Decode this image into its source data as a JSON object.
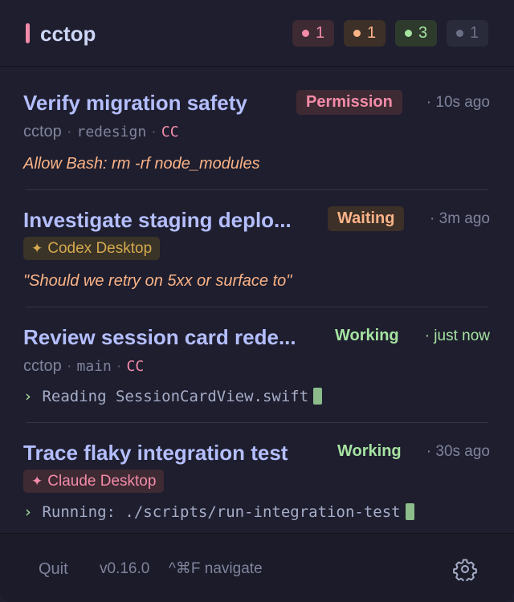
{
  "app": {
    "title": "cctop",
    "accent_color": "#f38ba8"
  },
  "badges": [
    {
      "count": "1",
      "color": "#f38ba8",
      "meaning": "permission"
    },
    {
      "count": "1",
      "color": "#fab387",
      "meaning": "waiting"
    },
    {
      "count": "3",
      "color": "#a6e3a1",
      "meaning": "working"
    },
    {
      "count": "1",
      "color": "#6c7086",
      "meaning": "idle"
    }
  ],
  "sessions": [
    {
      "title": "Verify migration safety",
      "status": "Permission",
      "time": "· 10s ago",
      "project": "cctop",
      "sep1": "·",
      "branch": "redesign",
      "sep2": "·",
      "agent": "CC",
      "detail": "Allow Bash: rm -rf node_modules"
    },
    {
      "title": "Investigate staging deplo...",
      "status": "Waiting",
      "time": "· 3m ago",
      "app_icon": "sparkle-icon",
      "app": "Codex Desktop",
      "detail": "\"Should we retry on 5xx or surface to\""
    },
    {
      "title": "Review session card rede...",
      "status": "Working",
      "time": "· just now",
      "project": "cctop",
      "sep1": "·",
      "branch": "main",
      "sep2": "·",
      "agent": "CC",
      "prompt": "›",
      "detail": "Reading SessionCardView.swift"
    },
    {
      "title": "Trace flaky integration test",
      "status": "Working",
      "time": "· 30s ago",
      "app_icon": "sparkle-icon",
      "app": "Claude Desktop",
      "prompt": "›",
      "detail": "Running: ./scripts/run-integration-test"
    }
  ],
  "footer": {
    "quit_label": "Quit",
    "version": "v0.16.0",
    "hint": "^⌘F navigate",
    "settings_icon": "gear-icon"
  }
}
